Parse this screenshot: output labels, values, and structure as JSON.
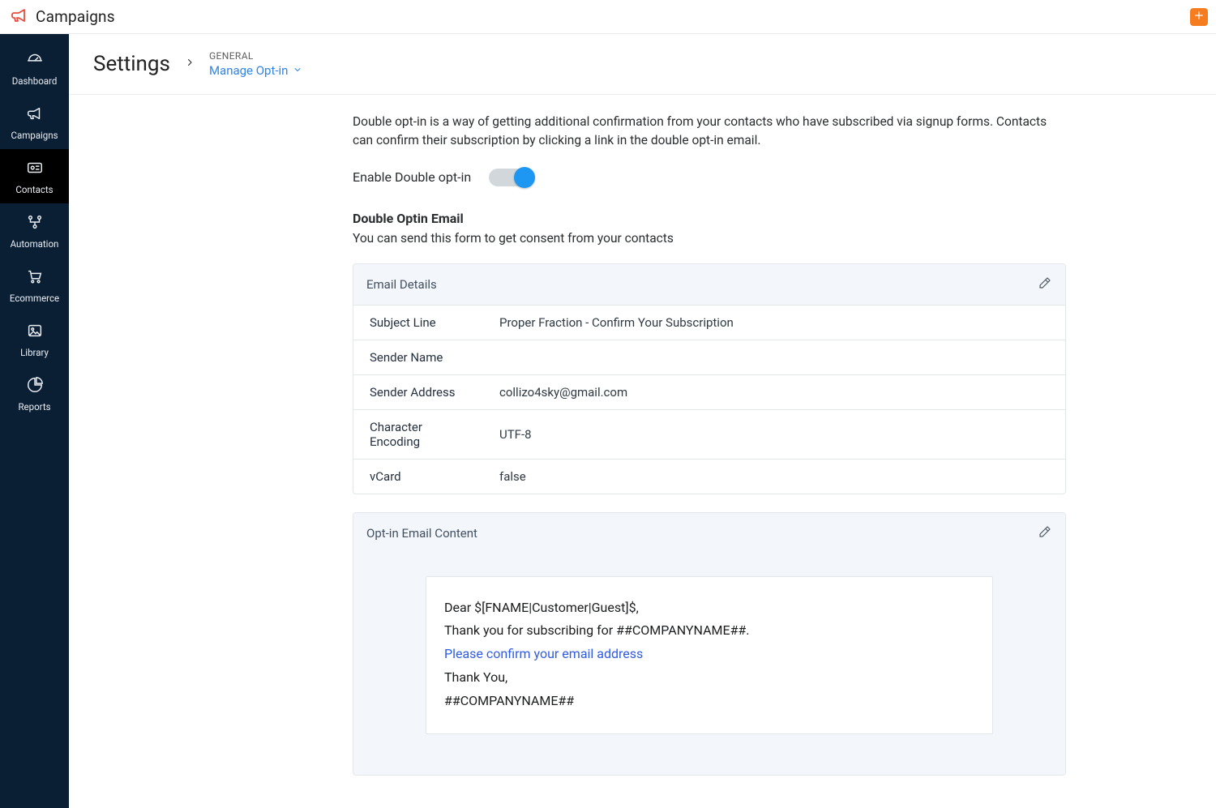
{
  "app": {
    "name": "Campaigns"
  },
  "sidebar": {
    "items": [
      {
        "label": "Dashboard"
      },
      {
        "label": "Campaigns"
      },
      {
        "label": "Contacts"
      },
      {
        "label": "Automation"
      },
      {
        "label": "Ecommerce"
      },
      {
        "label": "Library"
      },
      {
        "label": "Reports"
      }
    ],
    "active_index": 2
  },
  "breadcrumb": {
    "root": "Settings",
    "category": "GENERAL",
    "page": "Manage Opt-in"
  },
  "intro_text": "Double opt-in is a way of getting additional confirmation from your contacts who have subscribed via signup forms. Contacts can confirm their subscription by clicking a link in the double opt-in email.",
  "enable": {
    "label": "Enable Double opt-in",
    "state": true
  },
  "section": {
    "title": "Double Optin Email",
    "subtitle": "You can send this form to get consent from your contacts"
  },
  "email_details": {
    "title": "Email Details",
    "rows": [
      {
        "label": "Subject Line",
        "value": "Proper Fraction - Confirm Your Subscription"
      },
      {
        "label": "Sender Name",
        "value": ""
      },
      {
        "label": "Sender Address",
        "value": "collizo4sky@gmail.com"
      },
      {
        "label": "Character Encoding",
        "value": "UTF-8"
      },
      {
        "label": "vCard",
        "value": "false"
      }
    ]
  },
  "email_content": {
    "title": "Opt-in Email Content",
    "greeting": "Dear $[FNAME|Customer|Guest]$,",
    "thank_sub": "Thank you for subscribing for ##COMPANYNAME##.",
    "confirm_link_text": "Please confirm your email address",
    "sign_off": "Thank You,",
    "company_token": "##COMPANYNAME##"
  }
}
